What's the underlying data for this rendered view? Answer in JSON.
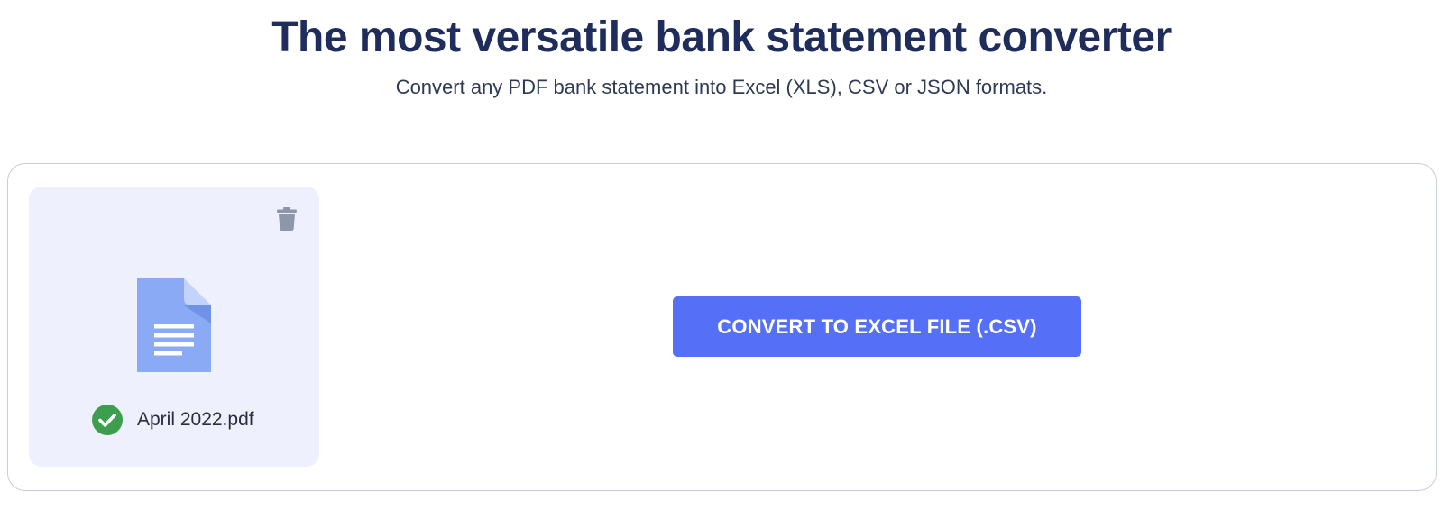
{
  "hero": {
    "title": "The most versatile bank statement converter",
    "subtitle": "Convert any PDF bank statement into Excel (XLS), CSV or JSON formats."
  },
  "file_card": {
    "file_name": "April 2022.pdf",
    "status": "uploaded",
    "icons": {
      "delete": "trash-icon",
      "document": "document-icon",
      "status": "check-circle-icon"
    }
  },
  "convert_button": {
    "label": "CONVERT TO EXCEL FILE (.CSV)"
  },
  "colors": {
    "title": "#1f2d5c",
    "accent": "#5570f6",
    "card_bg": "#eef1fd",
    "success": "#3d9f4e",
    "doc_blue": "#8aaaf5"
  }
}
